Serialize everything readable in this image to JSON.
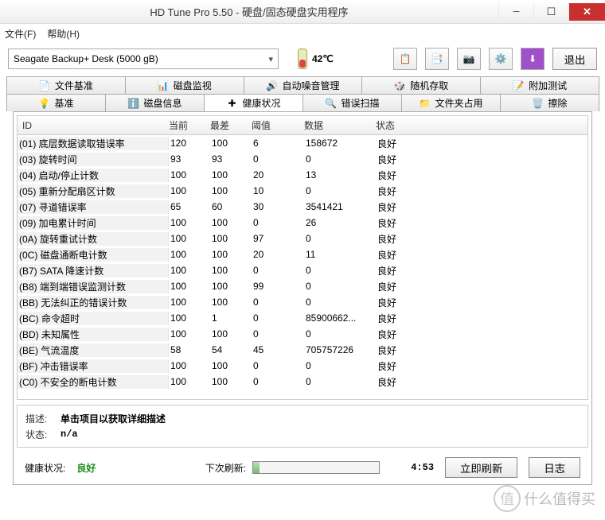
{
  "window_title": "HD Tune Pro 5.50 - 硬盘/固态硬盘实用程序",
  "menu": {
    "file": "文件(F)",
    "help": "帮助(H)"
  },
  "drive": "Seagate Backup+  Desk (5000 gB)",
  "temperature": "42℃",
  "exit_label": "退出",
  "tabs_row1": [
    {
      "label": "文件基准",
      "icon": "📄"
    },
    {
      "label": "磁盘监视",
      "icon": "📊"
    },
    {
      "label": "自动噪音管理",
      "icon": "🔊"
    },
    {
      "label": "随机存取",
      "icon": "🎲"
    },
    {
      "label": "附加测试",
      "icon": "📝"
    }
  ],
  "tabs_row2": [
    {
      "label": "基准",
      "icon": "💡"
    },
    {
      "label": "磁盘信息",
      "icon": "ℹ️"
    },
    {
      "label": "健康状况",
      "icon": "✚",
      "active": true
    },
    {
      "label": "错误扫描",
      "icon": "🔍"
    },
    {
      "label": "文件夹占用",
      "icon": "📁"
    },
    {
      "label": "擦除",
      "icon": "🗑️"
    }
  ],
  "columns": {
    "id": "ID",
    "current": "当前",
    "worst": "最差",
    "threshold": "阈值",
    "data": "数据",
    "status": "状态"
  },
  "rows": [
    {
      "id": "(01) 底层数据读取错误率",
      "cur": "120",
      "worst": "100",
      "th": "6",
      "data": "158672",
      "stat": "良好"
    },
    {
      "id": "(03) 旋转时间",
      "cur": "93",
      "worst": "93",
      "th": "0",
      "data": "0",
      "stat": "良好"
    },
    {
      "id": "(04) 启动/停止计数",
      "cur": "100",
      "worst": "100",
      "th": "20",
      "data": "13",
      "stat": "良好"
    },
    {
      "id": "(05) 重新分配扇区计数",
      "cur": "100",
      "worst": "100",
      "th": "10",
      "data": "0",
      "stat": "良好"
    },
    {
      "id": "(07) 寻道错误率",
      "cur": "65",
      "worst": "60",
      "th": "30",
      "data": "3541421",
      "stat": "良好"
    },
    {
      "id": "(09) 加电累计时间",
      "cur": "100",
      "worst": "100",
      "th": "0",
      "data": "26",
      "stat": "良好"
    },
    {
      "id": "(0A) 旋转重试计数",
      "cur": "100",
      "worst": "100",
      "th": "97",
      "data": "0",
      "stat": "良好"
    },
    {
      "id": "(0C) 磁盘通断电计数",
      "cur": "100",
      "worst": "100",
      "th": "20",
      "data": "11",
      "stat": "良好"
    },
    {
      "id": "(B7) SATA 降速计数",
      "cur": "100",
      "worst": "100",
      "th": "0",
      "data": "0",
      "stat": "良好"
    },
    {
      "id": "(B8) 端到端错误监测计数",
      "cur": "100",
      "worst": "100",
      "th": "99",
      "data": "0",
      "stat": "良好"
    },
    {
      "id": "(BB) 无法纠正的错误计数",
      "cur": "100",
      "worst": "100",
      "th": "0",
      "data": "0",
      "stat": "良好"
    },
    {
      "id": "(BC) 命令超时",
      "cur": "100",
      "worst": "1",
      "th": "0",
      "data": "85900662...",
      "stat": "良好"
    },
    {
      "id": "(BD) 未知属性",
      "cur": "100",
      "worst": "100",
      "th": "0",
      "data": "0",
      "stat": "良好"
    },
    {
      "id": "(BE) 气流温度",
      "cur": "58",
      "worst": "54",
      "th": "45",
      "data": "705757226",
      "stat": "良好"
    },
    {
      "id": "(BF) 冲击错误率",
      "cur": "100",
      "worst": "100",
      "th": "0",
      "data": "0",
      "stat": "良好"
    },
    {
      "id": "(C0) 不安全的断电计数",
      "cur": "100",
      "worst": "100",
      "th": "0",
      "data": "0",
      "stat": "良好"
    }
  ],
  "desc": {
    "label": "描述:",
    "value": "单击项目以获取详细描述",
    "status_label": "状态:",
    "status_value": "n/a"
  },
  "health": {
    "label": "健康状况:",
    "value": "良好"
  },
  "refresh": {
    "label": "下次刷新:",
    "timer": "4:53",
    "now": "立即刷新",
    "log": "日志"
  },
  "watermark": "什么值得买"
}
